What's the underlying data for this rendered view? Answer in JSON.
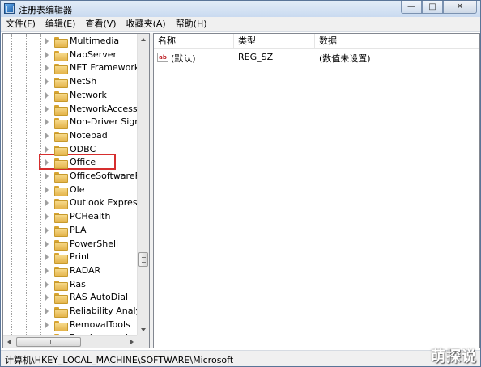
{
  "window": {
    "title": "注册表编辑器",
    "controls": {
      "minimize": "—",
      "maximize": "□",
      "close": "✕"
    }
  },
  "menu": [
    "文件(F)",
    "编辑(E)",
    "查看(V)",
    "收藏夹(A)",
    "帮助(H)"
  ],
  "tree": {
    "items": [
      "Multimedia",
      "NapServer",
      "NET Framework Se",
      "NetSh",
      "Network",
      "NetworkAccessPr",
      "Non-Driver Signin",
      "Notepad",
      "ODBC",
      "Office",
      "OfficeSoftwarePro",
      "Ole",
      "Outlook Express",
      "PCHealth",
      "PLA",
      "PowerShell",
      "Print",
      "RADAR",
      "Ras",
      "RAS AutoDial",
      "Reliability Analysis",
      "RemovalTools",
      "RendezvousApps"
    ],
    "highlighted": "Office"
  },
  "list": {
    "columns": [
      "名称",
      "类型",
      "数据"
    ],
    "rows": [
      {
        "icon": "ab",
        "name": "(默认)",
        "type": "REG_SZ",
        "data": "(数值未设置)"
      }
    ]
  },
  "status": {
    "path": "计算机\\HKEY_LOCAL_MACHINE\\SOFTWARE\\Microsoft"
  },
  "watermark": "萌探说",
  "colors": {
    "highlight_border": "#d62e2e",
    "folder": "#e4b44a"
  }
}
